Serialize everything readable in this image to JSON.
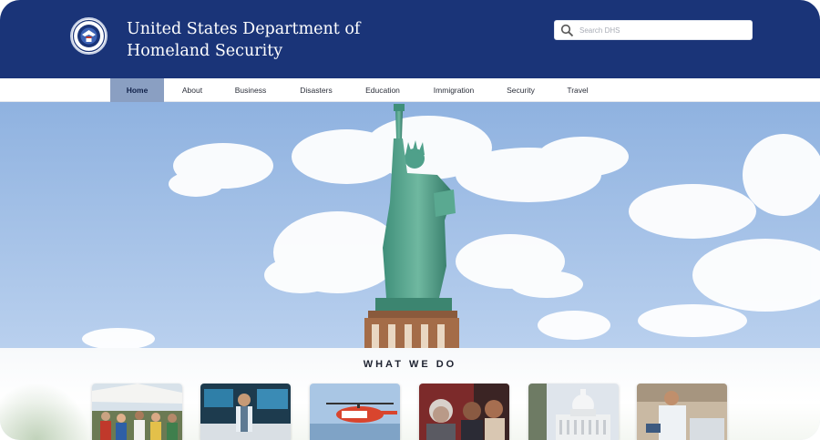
{
  "header": {
    "org_name_line1": "United States Department of",
    "org_name_line2": "Homeland Security",
    "seal_icon": "dhs-seal-icon",
    "background_color": "#1a3478"
  },
  "search": {
    "placeholder": "Search DHS",
    "value": "",
    "icon": "search-icon"
  },
  "nav": {
    "items": [
      {
        "label": "Home",
        "active": true
      },
      {
        "label": "About",
        "active": false
      },
      {
        "label": "Business",
        "active": false
      },
      {
        "label": "Disasters",
        "active": false
      },
      {
        "label": "Education",
        "active": false
      },
      {
        "label": "Immigration",
        "active": false
      },
      {
        "label": "Security",
        "active": false
      },
      {
        "label": "Travel",
        "active": false
      }
    ],
    "active_color": "#8a9fc2"
  },
  "hero": {
    "image": "statue-of-liberty-photo"
  },
  "what_we_do": {
    "title": "WHAT WE DO",
    "cards": [
      {
        "image": "crowd-outdoor-tent-photo"
      },
      {
        "image": "operations-center-photo"
      },
      {
        "image": "coast-guard-helicopter-photo"
      },
      {
        "image": "people-crowd-photo"
      },
      {
        "image": "capitol-building-photo"
      },
      {
        "image": "tsa-officer-photo"
      }
    ]
  }
}
